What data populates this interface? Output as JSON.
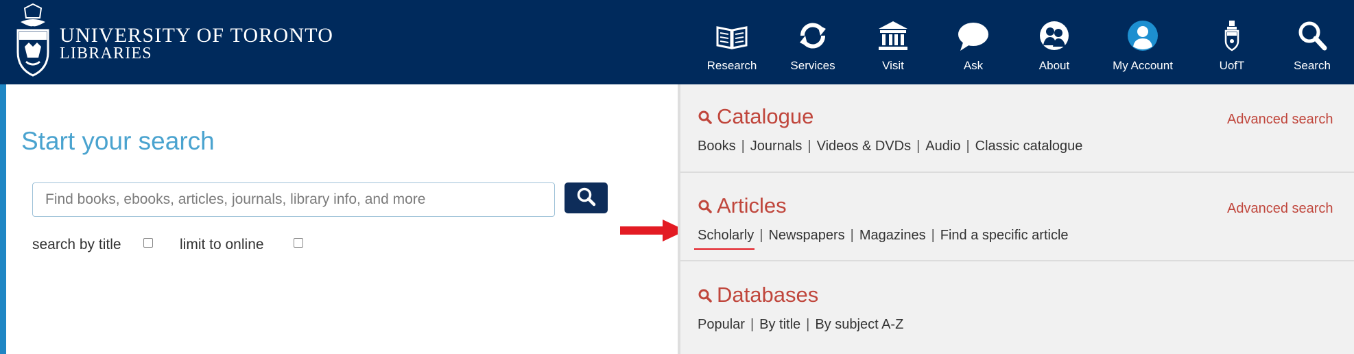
{
  "header": {
    "brand_line1": "UNIVERSITY OF TORONTO",
    "brand_line2": "LIBRARIES",
    "nav": [
      {
        "label": "Research",
        "icon": "book-icon"
      },
      {
        "label": "Services",
        "icon": "refresh-icon"
      },
      {
        "label": "Visit",
        "icon": "building-icon"
      },
      {
        "label": "Ask",
        "icon": "chat-bubble-icon"
      },
      {
        "label": "About",
        "icon": "people-icon"
      },
      {
        "label": "My Account",
        "icon": "user-icon"
      },
      {
        "label": "UofT",
        "icon": "crest-icon"
      },
      {
        "label": "Search",
        "icon": "search-icon"
      }
    ]
  },
  "left": {
    "title": "Start your search",
    "search_placeholder": "Find books, ebooks, articles, journals, library info, and more",
    "option_title": "search by title",
    "option_online": "limit to online"
  },
  "right": {
    "catalogue": {
      "title": "Catalogue",
      "advanced": "Advanced search",
      "links": [
        "Books",
        "Journals",
        "Videos & DVDs",
        "Audio",
        "Classic catalogue"
      ]
    },
    "articles": {
      "title": "Articles",
      "advanced": "Advanced search",
      "links": [
        "Scholarly",
        "Newspapers",
        "Magazines",
        "Find a specific article"
      ]
    },
    "databases": {
      "title": "Databases",
      "links": [
        "Popular",
        "By title",
        "By subject A-Z"
      ]
    }
  },
  "colors": {
    "header_bg": "#002a5c",
    "accent_red": "#c0463c",
    "title_blue": "#4aa3cf",
    "annotation_red": "#e31b23"
  }
}
